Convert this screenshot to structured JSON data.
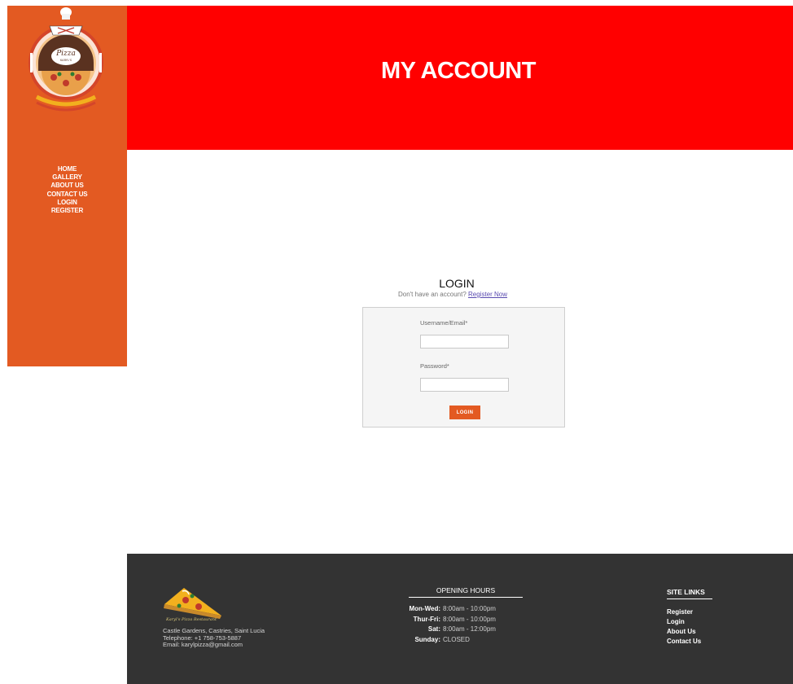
{
  "sidebar": {
    "nav": [
      {
        "label": "HOME"
      },
      {
        "label": "GALLERY"
      },
      {
        "label": "ABOUT US"
      },
      {
        "label": "CONTACT US"
      },
      {
        "label": "LOGIN"
      },
      {
        "label": "REGISTER"
      }
    ]
  },
  "header": {
    "title": "MY ACCOUNT"
  },
  "login": {
    "title": "LOGIN",
    "prompt": "Don't have an account?",
    "register_link": "Register Now",
    "username_label": "Username/Email*",
    "username_value": "",
    "password_label": "Password*",
    "password_value": "",
    "submit_label": "LOGIN"
  },
  "footer": {
    "contact": {
      "address": "Castle Gardens, Castries, Saint Lucia",
      "phone": "Telephone: +1 758-753-5887",
      "email": "Email: karylpizza@gmail.com"
    },
    "hours_title": "OPENING HOURS",
    "hours": [
      {
        "day": "Mon-Wed:",
        "time": "8:00am - 10:00pm"
      },
      {
        "day": "Thur-Fri:",
        "time": "8:00am - 10:00pm"
      },
      {
        "day": "Sat:",
        "time": "8:00am - 12:00pm"
      },
      {
        "day": "Sunday:",
        "time": "CLOSED"
      }
    ],
    "links_title": "SITE LINKS",
    "links": [
      {
        "label": "Register"
      },
      {
        "label": "Login"
      },
      {
        "label": "About Us"
      },
      {
        "label": "Contact Us"
      }
    ]
  },
  "colors": {
    "sidebar": "#e35a22",
    "header": "#ff0000",
    "footer": "#333333",
    "button": "#e35a22"
  }
}
